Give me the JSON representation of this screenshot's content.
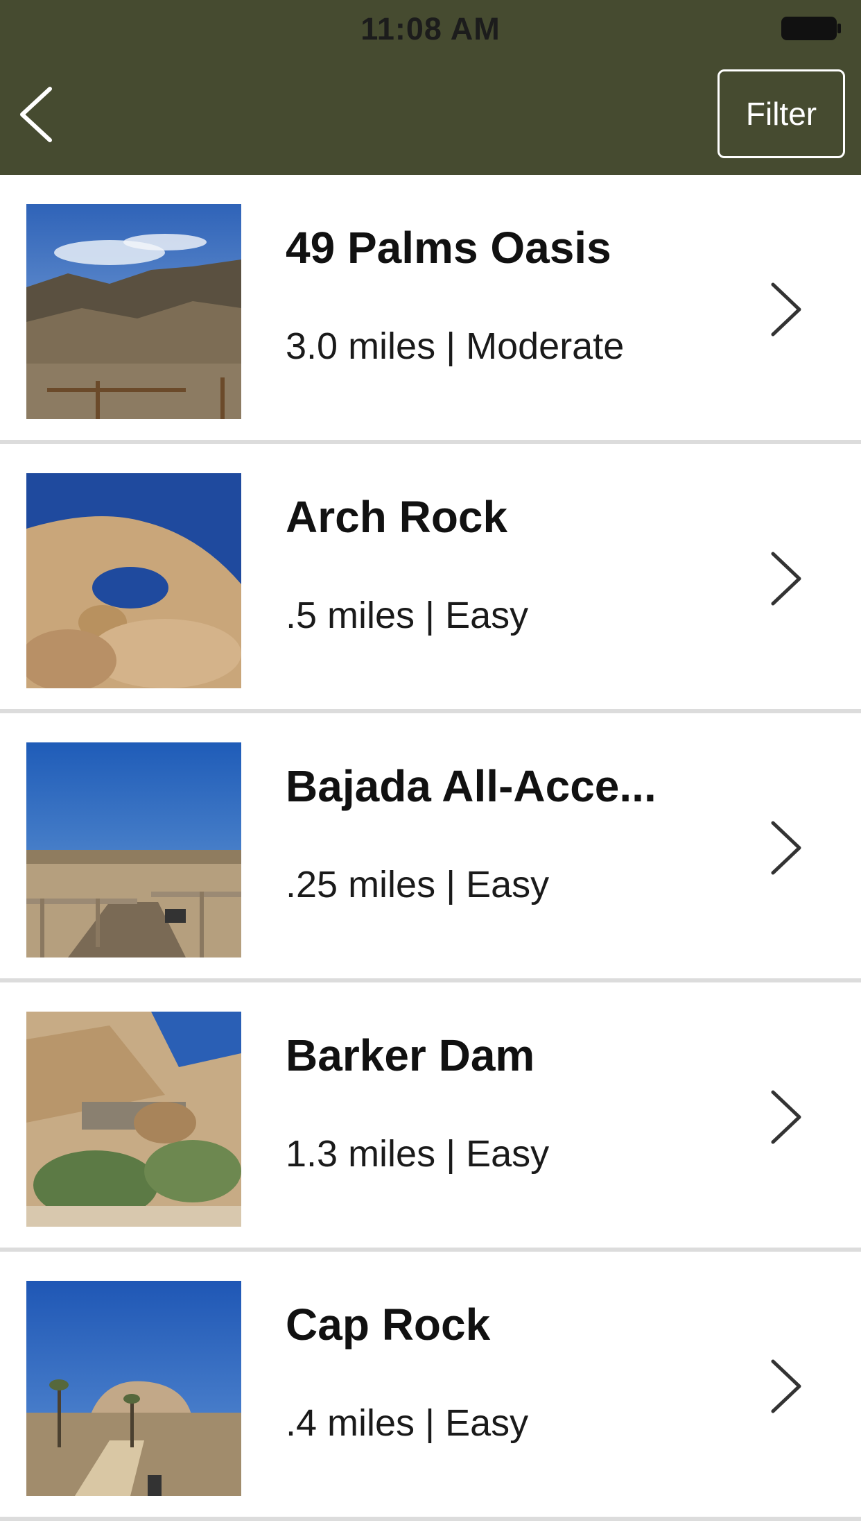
{
  "status_bar": {
    "time": "11:08 AM",
    "battery_icon": "battery-full-icon"
  },
  "nav": {
    "back_icon": "chevron-left-icon",
    "filter_label": "Filter",
    "header_color": "#464b30"
  },
  "trails": [
    {
      "name": "49 Palms Oasis",
      "meta": "3.0 miles | Moderate",
      "thumbnail": "desert-canyon-photo"
    },
    {
      "name": "Arch Rock",
      "meta": ".5 miles | Easy",
      "thumbnail": "arch-rock-photo"
    },
    {
      "name": "Bajada All-Acce...",
      "meta": ".25 miles | Easy",
      "thumbnail": "boardwalk-photo"
    },
    {
      "name": "Barker Dam",
      "meta": "1.3 miles | Easy",
      "thumbnail": "dam-rocks-photo"
    },
    {
      "name": "Cap Rock",
      "meta": ".4 miles | Easy",
      "thumbnail": "cap-rock-photo"
    }
  ]
}
